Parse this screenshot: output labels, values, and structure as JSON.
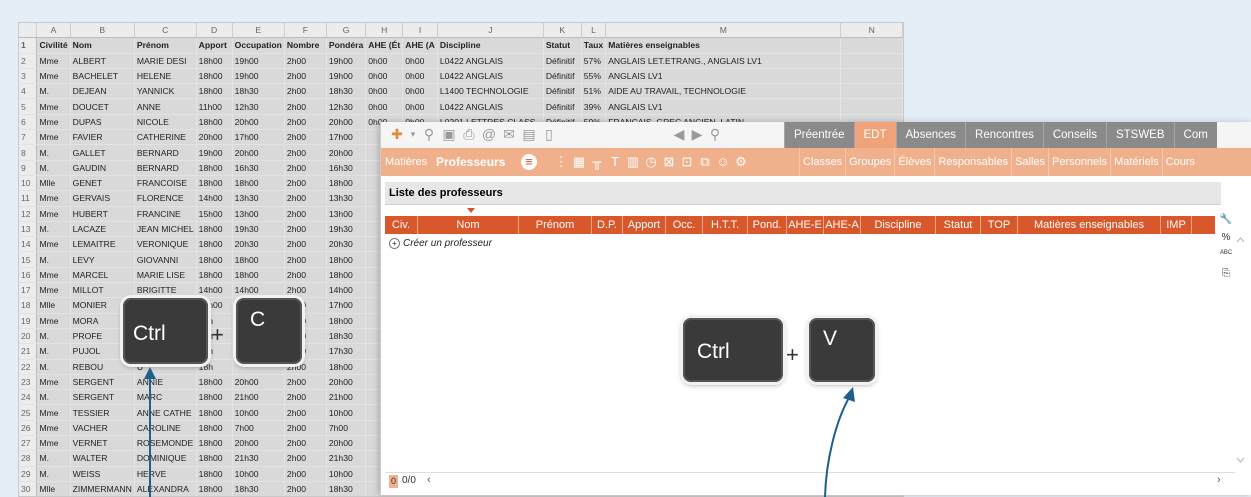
{
  "spreadsheet": {
    "columns": [
      "A",
      "B",
      "C",
      "D",
      "E",
      "F",
      "G",
      "H",
      "I",
      "J",
      "K",
      "L",
      "M",
      "N"
    ],
    "header_row": [
      "Civilité",
      "Nom",
      "Prénom",
      "Apport",
      "Occupation",
      "Nombre",
      "Pondéra",
      "AHE (Ét",
      "AHE (A",
      "Discipline",
      "Statut",
      "Taux",
      "Matières enseignables",
      ""
    ],
    "rows": [
      [
        "Mme",
        "ALBERT",
        "MARIE DESI",
        "18h00",
        "19h00",
        "2h00",
        "19h00",
        "0h00",
        "0h00",
        "L0422  ANGLAIS",
        "Définitif",
        "57%",
        "ANGLAIS LET.ETRANG., ANGLAIS LV1",
        ""
      ],
      [
        "Mme",
        "BACHELET",
        "HELENE",
        "18h00",
        "19h00",
        "2h00",
        "19h00",
        "0h00",
        "0h00",
        "L0422  ANGLAIS",
        "Définitif",
        "55%",
        "ANGLAIS LV1",
        ""
      ],
      [
        "M.",
        "DEJEAN",
        "YANNICK",
        "18h00",
        "18h30",
        "2h00",
        "18h30",
        "0h00",
        "0h00",
        "L1400  TECHNOLOGIE",
        "Définitif",
        "51%",
        "AIDE AU TRAVAIL, TECHNOLOGIE",
        ""
      ],
      [
        "Mme",
        "DOUCET",
        "ANNE",
        "11h00",
        "12h30",
        "2h00",
        "12h30",
        "0h00",
        "0h00",
        "L0422  ANGLAIS",
        "Définitif",
        "39%",
        "ANGLAIS LV1",
        ""
      ],
      [
        "Mme",
        "DUPAS",
        "NICOLE",
        "18h00",
        "20h00",
        "2h00",
        "20h00",
        "0h00",
        "0h00",
        "L0201  LETTRES CLASS",
        "Définitif",
        "59%",
        "FRANCAIS, GREC ANCIEN, LATIN",
        ""
      ],
      [
        "Mme",
        "FAVIER",
        "CATHERINE",
        "20h00",
        "17h00",
        "2h00",
        "17h00",
        "",
        "",
        "",
        "",
        "",
        "",
        ""
      ],
      [
        "M.",
        "GALLET",
        "BERNARD",
        "19h00",
        "20h00",
        "2h00",
        "20h00",
        "",
        "",
        "",
        "",
        "",
        "",
        ""
      ],
      [
        "M.",
        "GAUDIN",
        "BERNARD",
        "18h00",
        "16h30",
        "2h00",
        "16h30",
        "",
        "",
        "",
        "",
        "",
        "",
        ""
      ],
      [
        "Mlle",
        "GENET",
        "FRANCOISE",
        "18h00",
        "18h00",
        "2h00",
        "18h00",
        "",
        "",
        "",
        "",
        "",
        "",
        ""
      ],
      [
        "Mme",
        "GERVAIS",
        "FLORENCE",
        "14h00",
        "13h30",
        "2h00",
        "13h30",
        "",
        "",
        "",
        "",
        "",
        "",
        ""
      ],
      [
        "Mme",
        "HUBERT",
        "FRANCINE",
        "15h00",
        "13h00",
        "2h00",
        "13h00",
        "",
        "",
        "",
        "",
        "",
        "",
        ""
      ],
      [
        "M.",
        "LACAZE",
        "JEAN MICHEL",
        "18h00",
        "19h30",
        "2h00",
        "19h30",
        "",
        "",
        "",
        "",
        "",
        "",
        ""
      ],
      [
        "Mme",
        "LEMAITRE",
        "VERONIQUE",
        "18h00",
        "20h30",
        "2h00",
        "20h30",
        "",
        "",
        "",
        "",
        "",
        "",
        ""
      ],
      [
        "M.",
        "LEVY",
        "GIOVANNI",
        "18h00",
        "18h00",
        "2h00",
        "18h00",
        "",
        "",
        "",
        "",
        "",
        "",
        ""
      ],
      [
        "Mme",
        "MARCEL",
        "MARIE LISE",
        "18h00",
        "18h00",
        "2h00",
        "18h00",
        "",
        "",
        "",
        "",
        "",
        "",
        ""
      ],
      [
        "Mme",
        "MILLOT",
        "BRIGITTE",
        "14h00",
        "14h00",
        "2h00",
        "14h00",
        "",
        "",
        "",
        "",
        "",
        "",
        ""
      ],
      [
        "Mlle",
        "MONIER",
        "THALIA",
        "18h00",
        "17h00",
        "2h00",
        "17h00",
        "",
        "",
        "",
        "",
        "",
        "",
        ""
      ],
      [
        "Mme",
        "MORA",
        "",
        "18h",
        "",
        "2h00",
        "18h00",
        "",
        "",
        "",
        "",
        "",
        "",
        ""
      ],
      [
        "M.",
        "PROFE",
        "",
        "18h",
        "",
        "2h00",
        "18h30",
        "",
        "",
        "",
        "",
        "",
        "",
        ""
      ],
      [
        "M.",
        "PUJOL",
        "",
        "20h",
        "",
        "2h00",
        "17h30",
        "",
        "",
        "",
        "",
        "",
        "",
        ""
      ],
      [
        "M.",
        "REBOU",
        "U",
        "18h",
        "",
        "2h00",
        "18h00",
        "",
        "",
        "",
        "",
        "",
        "",
        ""
      ],
      [
        "Mme",
        "SERGENT",
        "ANNIE",
        "18h00",
        "20h00",
        "2h00",
        "20h00",
        "",
        "",
        "",
        "",
        "",
        "",
        ""
      ],
      [
        "M.",
        "SERGENT",
        "MARC",
        "18h00",
        "21h00",
        "2h00",
        "21h00",
        "",
        "",
        "",
        "",
        "",
        "",
        ""
      ],
      [
        "Mme",
        "TESSIER",
        "ANNE CATHE",
        "18h00",
        "10h00",
        "2h00",
        "10h00",
        "",
        "",
        "",
        "",
        "",
        "",
        ""
      ],
      [
        "Mme",
        "VACHER",
        "CAROLINE",
        "18h00",
        "7h00",
        "2h00",
        "7h00",
        "",
        "",
        "",
        "",
        "",
        "",
        ""
      ],
      [
        "Mme",
        "VERNET",
        "ROSEMONDE",
        "18h00",
        "20h00",
        "2h00",
        "20h00",
        "",
        "",
        "",
        "",
        "",
        "",
        ""
      ],
      [
        "M.",
        "WALTER",
        "DOMINIQUE",
        "18h00",
        "21h30",
        "2h00",
        "21h30",
        "",
        "",
        "",
        "",
        "",
        "",
        ""
      ],
      [
        "M.",
        "WEISS",
        "HERVE",
        "18h00",
        "10h00",
        "2h00",
        "10h00",
        "",
        "",
        "",
        "",
        "",
        "",
        ""
      ],
      [
        "Mlle",
        "ZIMMERMANN",
        "ALEXANDRA",
        "18h00",
        "18h30",
        "2h00",
        "18h30",
        "",
        "",
        "",
        "",
        "",
        "",
        ""
      ]
    ]
  },
  "keys": {
    "copy_mod": "Ctrl",
    "copy_key": "C",
    "paste_mod": "Ctrl",
    "paste_key": "V",
    "plus": "+"
  },
  "app": {
    "nav_tabs": [
      "Préentrée",
      "EDT",
      "Absences",
      "Rencontres",
      "Conseils",
      "STSWEB",
      "Com"
    ],
    "active_nav": "EDT",
    "ribbon_left": [
      "Matières",
      "Professeurs"
    ],
    "ribbon_right": [
      "Classes",
      "Groupes",
      "Élèves",
      "Responsables",
      "Salles",
      "Personnels",
      "Matériels",
      "Cours"
    ],
    "list_title": "Liste des professeurs",
    "columns": [
      "Civ.",
      "Nom",
      "Prénom",
      "D.P.",
      "Apport",
      "Occ.",
      "H.T.T.",
      "Pond.",
      "AHE-E",
      "AHE-A",
      "Discipline",
      "Statut",
      "TOP",
      "Matières enseignables",
      "IMP"
    ],
    "create_label": "Créer un professeur",
    "pager": "0/0",
    "pager_box": "0",
    "side_icons": [
      "wrench-icon",
      "percent-icon",
      "abc-icon",
      "copy-icon"
    ],
    "side_labels": [
      "🔧",
      "%",
      "ABC",
      "⎘"
    ]
  },
  "colors": {
    "orange_dark": "#d9582b",
    "orange_light": "#f0b08c",
    "arrow": "#1f5f8b",
    "key_bg": "#3a3a3a"
  }
}
